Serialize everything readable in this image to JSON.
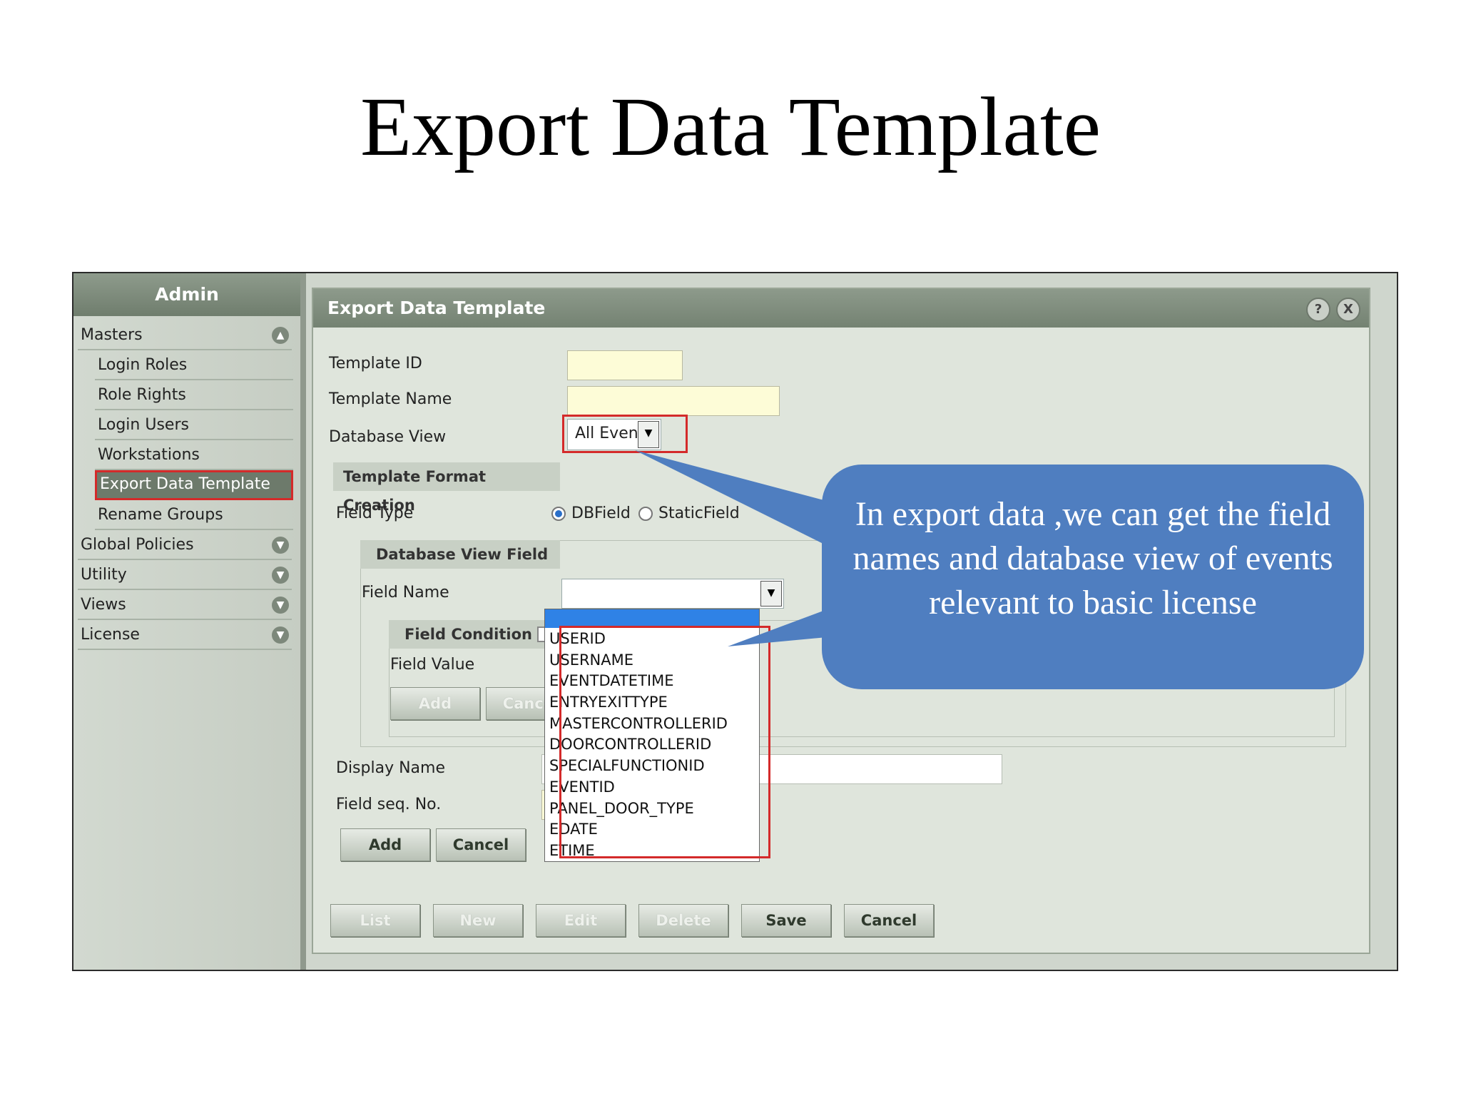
{
  "slide": {
    "title": "Export Data Template"
  },
  "sidebar": {
    "header": "Admin",
    "sections": [
      {
        "label": "Masters",
        "expanded": true
      },
      {
        "label": "Global Policies",
        "expanded": false
      },
      {
        "label": "Utility",
        "expanded": false
      },
      {
        "label": "Views",
        "expanded": false
      },
      {
        "label": "License",
        "expanded": false
      }
    ],
    "masters_items": [
      "Login Roles",
      "Role Rights",
      "Login Users",
      "Workstations",
      "Export Data Template",
      "Rename Groups"
    ],
    "active_item": "Export Data Template"
  },
  "panel": {
    "title": "Export Data Template",
    "help_label": "?",
    "close_label": "X",
    "template_id_label": "Template ID",
    "template_name_label": "Template Name",
    "database_view_label": "Database View",
    "database_view_value": "All Events",
    "format_section_title": "Template Format Creation",
    "field_type_label": "Field Type",
    "field_type_options": [
      "DBField",
      "StaticField"
    ],
    "field_type_selected": "DBField",
    "db_view_field_title": "Database View Field",
    "field_name_label": "Field Name",
    "field_condition_label": "Field Condition",
    "field_value_label": "Field Value",
    "condition_add_label": "Add",
    "condition_cancel_label": "Cancel",
    "display_name_label": "Display Name",
    "field_seq_label": "Field seq. No.",
    "add_label": "Add",
    "cancel_label": "Cancel"
  },
  "dropdown": {
    "items": [
      "USERID",
      "USERNAME",
      "EVENTDATETIME",
      "ENTRYEXITTYPE",
      "MASTERCONTROLLERID",
      "DOORCONTROLLERID",
      "SPECIALFUNCTIONID",
      "EVENTID",
      "PANEL_DOOR_TYPE",
      "EDATE",
      "ETIME"
    ]
  },
  "footer_buttons": {
    "list": "List",
    "new": "New",
    "edit": "Edit",
    "delete": "Delete",
    "save": "Save",
    "cancel": "Cancel"
  },
  "callout": {
    "text": "In export data ,we can get the field names and database view of events relevant to basic license"
  },
  "colors": {
    "callout": "#4f7ec0",
    "highlight_red": "#d42a2a",
    "dropdown_selected": "#2f82e6"
  }
}
